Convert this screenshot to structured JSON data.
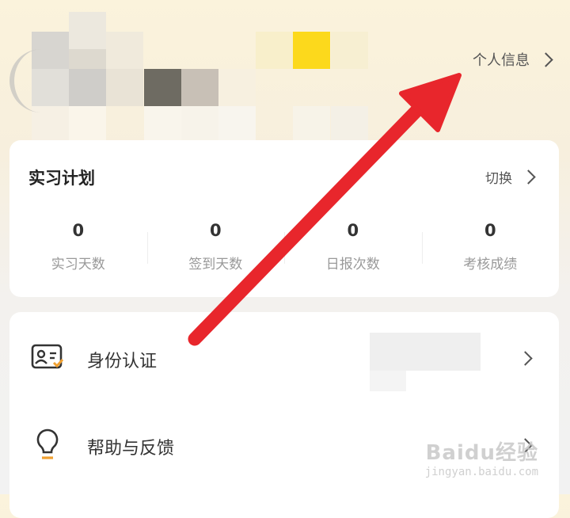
{
  "header": {
    "profile_link_label": "个人信息"
  },
  "plan": {
    "title": "实习计划",
    "switch_label": "切换",
    "stats": [
      {
        "value": "0",
        "label": "实习天数"
      },
      {
        "value": "0",
        "label": "签到天数"
      },
      {
        "value": "0",
        "label": "日报次数"
      },
      {
        "value": "0",
        "label": "考核成绩"
      }
    ]
  },
  "menu": {
    "items": [
      {
        "label": "身份认证",
        "icon": "id-card-icon"
      },
      {
        "label": "帮助与反馈",
        "icon": "lightbulb-icon"
      }
    ]
  },
  "colors": {
    "arrow": "#e8262c",
    "accent_orange": "#f0a030",
    "background_top": "#fbf3dc"
  },
  "watermark": {
    "main": "Baidu经验",
    "sub": "jingyan.baidu.com"
  }
}
